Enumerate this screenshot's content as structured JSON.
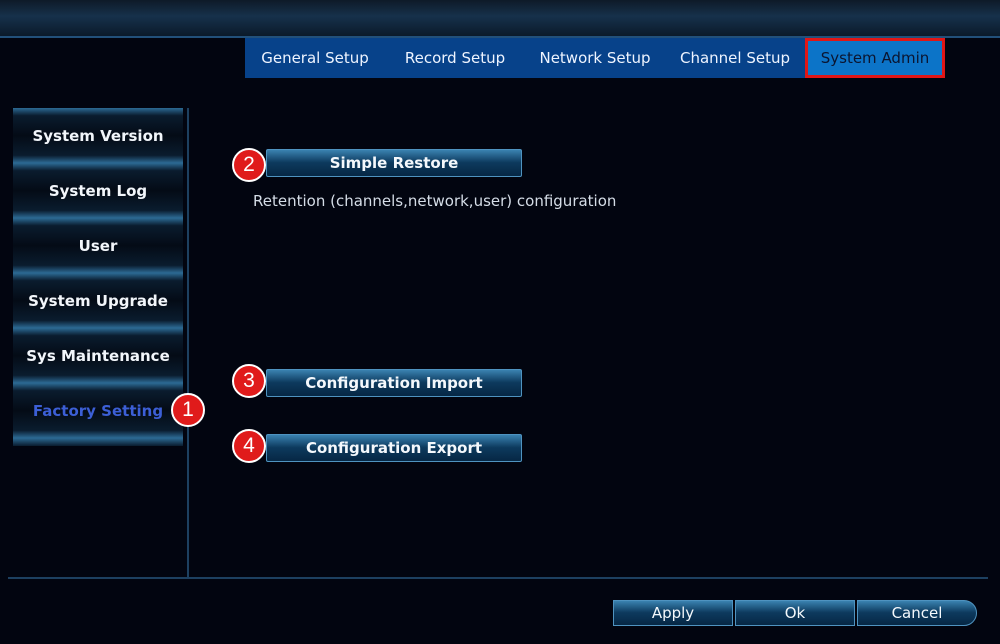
{
  "tabs": [
    {
      "label": "General Setup",
      "active": false
    },
    {
      "label": "Record Setup",
      "active": false
    },
    {
      "label": "Network Setup",
      "active": false
    },
    {
      "label": "Channel Setup",
      "active": false
    },
    {
      "label": "System Admin",
      "active": true
    }
  ],
  "sidebar": {
    "items": [
      {
        "label": "System Version"
      },
      {
        "label": "System Log"
      },
      {
        "label": "User"
      },
      {
        "label": "System Upgrade"
      },
      {
        "label": "Sys Maintenance"
      },
      {
        "label": "Factory Setting",
        "active": true
      }
    ]
  },
  "main": {
    "simple_restore_label": "Simple Restore",
    "simple_restore_desc": "Retention (channels,network,user) configuration",
    "config_import_label": "Configuration Import",
    "config_export_label": "Configuration Export"
  },
  "markers": [
    "1",
    "2",
    "3",
    "4"
  ],
  "footer": {
    "apply_label": "Apply",
    "ok_label": "Ok",
    "cancel_label": "Cancel"
  },
  "colors": {
    "accent_active_tab": "#0c74c8",
    "highlight_border": "#e01616",
    "active_sidebar_text": "#3c5fd6"
  }
}
